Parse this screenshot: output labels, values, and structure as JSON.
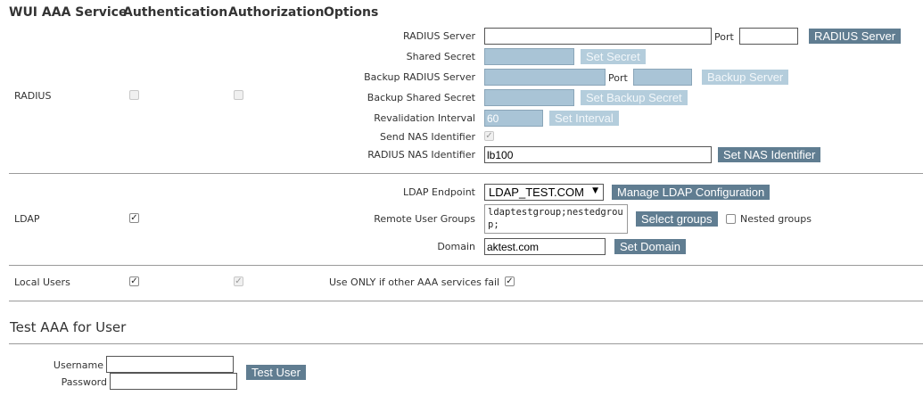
{
  "tabs": [
    "WUI AAA Service",
    "Authentication",
    "Authorization",
    "Options"
  ],
  "radius": {
    "row_label": "RADIUS",
    "server_label": "RADIUS Server",
    "server_value": "",
    "port_label": "Port",
    "port_value": "",
    "server_button": "RADIUS Server",
    "secret_label": "Shared Secret",
    "secret_button": "Set Secret",
    "backup_server_label": "Backup RADIUS Server",
    "backup_port_label": "Port",
    "backup_server_button": "Backup Server",
    "backup_secret_label": "Backup Shared Secret",
    "backup_secret_button": "Set Backup Secret",
    "revalidation_label": "Revalidation Interval",
    "revalidation_value": "60",
    "revalidation_button": "Set Interval",
    "send_nas_label": "Send NAS Identifier",
    "nas_id_label": "RADIUS NAS Identifier",
    "nas_id_value": "lb100",
    "nas_id_button": "Set NAS Identifier"
  },
  "ldap": {
    "row_label": "LDAP",
    "endpoint_label": "LDAP Endpoint",
    "endpoint_value": "LDAP_TEST.COM",
    "manage_button": "Manage LDAP Configuration",
    "groups_label": "Remote User Groups",
    "groups_value": "ldaptestgroup;nestedgroup;",
    "select_groups_button": "Select groups",
    "nested_label": "Nested groups",
    "domain_label": "Domain",
    "domain_value": "aktest.com",
    "domain_button": "Set Domain"
  },
  "local": {
    "row_label": "Local Users",
    "only_label": "Use ONLY if other AAA services fail"
  },
  "test": {
    "title": "Test AAA for User",
    "username_label": "Username",
    "password_label": "Password",
    "test_button": "Test User"
  },
  "colors": {
    "button": "#607d91",
    "button_disabled": "#b4cddc",
    "input_disabled": "#a9c4d6"
  }
}
